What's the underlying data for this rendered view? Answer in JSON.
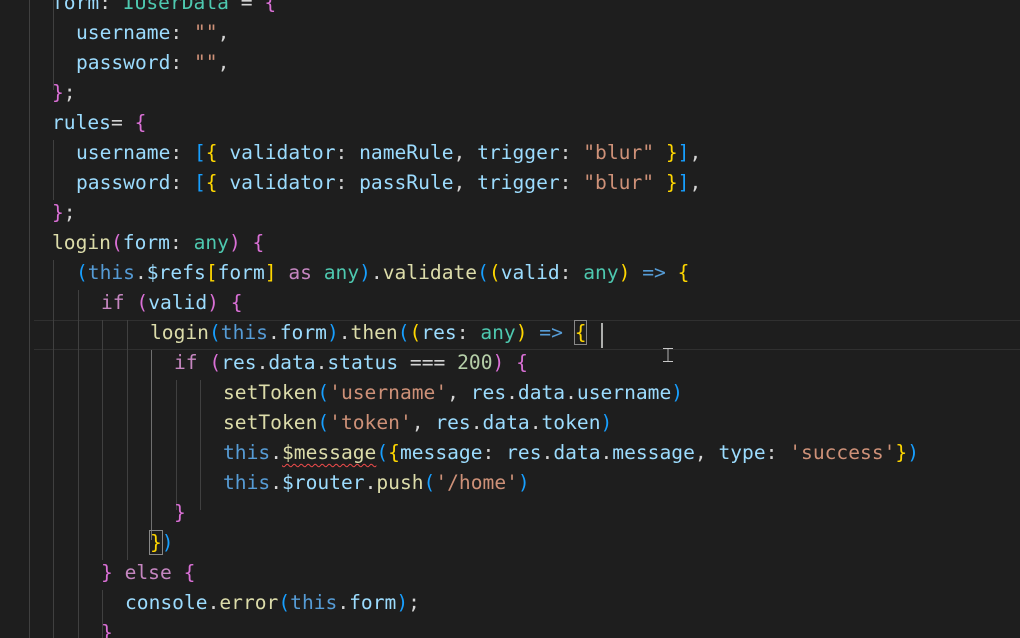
{
  "editor": {
    "language": "TypeScript",
    "cursor_after": "(res: any) => {",
    "lines": [
      [
        [
          "form",
          "p"
        ],
        [
          ": ",
          "o"
        ],
        [
          "IUserData",
          "t"
        ],
        [
          " = ",
          "o"
        ],
        [
          "{",
          "b2"
        ]
      ],
      [
        [
          "username",
          "p"
        ],
        [
          ": ",
          "o"
        ],
        [
          "\"\"",
          "s"
        ],
        [
          ",",
          "o"
        ]
      ],
      [
        [
          "password",
          "p"
        ],
        [
          ": ",
          "o"
        ],
        [
          "\"\"",
          "s"
        ],
        [
          ",",
          "o"
        ]
      ],
      [
        [
          "}",
          "b2"
        ],
        [
          ";",
          "o"
        ]
      ],
      [
        [
          "rules",
          "p"
        ],
        [
          "= ",
          "o"
        ],
        [
          "{",
          "b2"
        ]
      ],
      [
        [
          "username",
          "p"
        ],
        [
          ": ",
          "o"
        ],
        [
          "[",
          "b3"
        ],
        [
          "{",
          "b1"
        ],
        [
          " validator",
          "p"
        ],
        [
          ": ",
          "o"
        ],
        [
          "nameRule",
          "p"
        ],
        [
          ", ",
          "o"
        ],
        [
          "trigger",
          "p"
        ],
        [
          ": ",
          "o"
        ],
        [
          "\"blur\"",
          "s"
        ],
        [
          " ",
          "o"
        ],
        [
          "}",
          "b1"
        ],
        [
          "]",
          "b3"
        ],
        [
          ",",
          "o"
        ]
      ],
      [
        [
          "password",
          "p"
        ],
        [
          ": ",
          "o"
        ],
        [
          "[",
          "b3"
        ],
        [
          "{",
          "b1"
        ],
        [
          " validator",
          "p"
        ],
        [
          ": ",
          "o"
        ],
        [
          "passRule",
          "p"
        ],
        [
          ", ",
          "o"
        ],
        [
          "trigger",
          "p"
        ],
        [
          ": ",
          "o"
        ],
        [
          "\"blur\"",
          "s"
        ],
        [
          " ",
          "o"
        ],
        [
          "}",
          "b1"
        ],
        [
          "]",
          "b3"
        ],
        [
          ",",
          "o"
        ]
      ],
      [
        [
          "}",
          "b2"
        ],
        [
          ";",
          "o"
        ]
      ],
      [
        [
          "login",
          "f"
        ],
        [
          "(",
          "b2"
        ],
        [
          "form",
          "p"
        ],
        [
          ": ",
          "o"
        ],
        [
          "any",
          "t"
        ],
        [
          ") ",
          "b2"
        ],
        [
          "{",
          "b2"
        ]
      ],
      [
        [
          "(",
          "b3"
        ],
        [
          "this",
          "kw"
        ],
        [
          ".",
          "o"
        ],
        [
          "$refs",
          "p"
        ],
        [
          "[",
          "b1"
        ],
        [
          "form",
          "p"
        ],
        [
          "]",
          "b1"
        ],
        [
          " as ",
          "k"
        ],
        [
          "any",
          "t"
        ],
        [
          ")",
          "b3"
        ],
        [
          ".",
          "o"
        ],
        [
          "validate",
          "f"
        ],
        [
          "(",
          "b3"
        ],
        [
          "(",
          "b1"
        ],
        [
          "valid",
          "p"
        ],
        [
          ": ",
          "o"
        ],
        [
          "any",
          "t"
        ],
        [
          ")",
          "b1"
        ],
        [
          " => ",
          "kw"
        ],
        [
          "{",
          "b1"
        ]
      ],
      [
        [
          "if",
          "k"
        ],
        [
          " ",
          "o"
        ],
        [
          "(",
          "b2"
        ],
        [
          "valid",
          "p"
        ],
        [
          ") ",
          "b2"
        ],
        [
          "{",
          "b2"
        ]
      ],
      [
        [
          "login",
          "f"
        ],
        [
          "(",
          "b3"
        ],
        [
          "this",
          "kw"
        ],
        [
          ".",
          "o"
        ],
        [
          "form",
          "p"
        ],
        [
          ")",
          "b3"
        ],
        [
          ".",
          "o"
        ],
        [
          "then",
          "f"
        ],
        [
          "(",
          "b3"
        ],
        [
          "(",
          "b1"
        ],
        [
          "res",
          "p"
        ],
        [
          ": ",
          "o"
        ],
        [
          "any",
          "t"
        ],
        [
          ")",
          "b1"
        ],
        [
          " => ",
          "kw"
        ],
        [
          "{",
          "b1"
        ]
      ],
      [
        [
          "if",
          "k"
        ],
        [
          " ",
          "o"
        ],
        [
          "(",
          "b2"
        ],
        [
          "res",
          "p"
        ],
        [
          ".",
          "o"
        ],
        [
          "data",
          "p"
        ],
        [
          ".",
          "o"
        ],
        [
          "status",
          "p"
        ],
        [
          " === ",
          "o"
        ],
        [
          "200",
          "n"
        ],
        [
          ") ",
          "b2"
        ],
        [
          "{",
          "b2"
        ]
      ],
      [
        [
          "setToken",
          "f"
        ],
        [
          "(",
          "b3"
        ],
        [
          "'username'",
          "s"
        ],
        [
          ", ",
          "o"
        ],
        [
          "res",
          "p"
        ],
        [
          ".",
          "o"
        ],
        [
          "data",
          "p"
        ],
        [
          ".",
          "o"
        ],
        [
          "username",
          "p"
        ],
        [
          ")",
          "b3"
        ]
      ],
      [
        [
          "setToken",
          "f"
        ],
        [
          "(",
          "b3"
        ],
        [
          "'token'",
          "s"
        ],
        [
          ", ",
          "o"
        ],
        [
          "res",
          "p"
        ],
        [
          ".",
          "o"
        ],
        [
          "data",
          "p"
        ],
        [
          ".",
          "o"
        ],
        [
          "token",
          "p"
        ],
        [
          ")",
          "b3"
        ]
      ],
      [
        [
          "this",
          "kw"
        ],
        [
          ".",
          "o"
        ],
        [
          "$message",
          "f"
        ],
        [
          "(",
          "b3"
        ],
        [
          "{",
          "b1"
        ],
        [
          "message",
          "p"
        ],
        [
          ": ",
          "o"
        ],
        [
          "res",
          "p"
        ],
        [
          ".",
          "o"
        ],
        [
          "data",
          "p"
        ],
        [
          ".",
          "o"
        ],
        [
          "message",
          "p"
        ],
        [
          ", ",
          "o"
        ],
        [
          "type",
          "p"
        ],
        [
          ": ",
          "o"
        ],
        [
          "'success'",
          "s"
        ],
        [
          "}",
          "b1"
        ],
        [
          ")",
          "b3"
        ]
      ],
      [
        [
          "this",
          "kw"
        ],
        [
          ".",
          "o"
        ],
        [
          "$router",
          "p"
        ],
        [
          ".",
          "o"
        ],
        [
          "push",
          "f"
        ],
        [
          "(",
          "b3"
        ],
        [
          "'/home'",
          "s"
        ],
        [
          ")",
          "b3"
        ]
      ],
      [
        [
          "}",
          "b2"
        ]
      ],
      [
        [
          "}",
          "b1"
        ],
        [
          ")",
          "b3"
        ]
      ],
      [
        [
          "}",
          "b2"
        ],
        [
          " else ",
          "k"
        ],
        [
          "{",
          "b2"
        ]
      ],
      [
        [
          "console",
          "p"
        ],
        [
          ".",
          "o"
        ],
        [
          "error",
          "f"
        ],
        [
          "(",
          "b3"
        ],
        [
          "this",
          "kw"
        ],
        [
          ".",
          "o"
        ],
        [
          "form",
          "p"
        ],
        [
          ")",
          "b3"
        ],
        [
          ";",
          "o"
        ]
      ],
      [
        [
          "}",
          "b2"
        ]
      ]
    ]
  },
  "icons": {
    "text_cursor": "ibeam-cursor-icon",
    "error_marker": "error-squiggle"
  },
  "colors": {
    "background": "#1e1e1e",
    "keyword": "#c586c0",
    "this_keyword": "#569cd6",
    "variable": "#9cdcfe",
    "function": "#dcdcaa",
    "type": "#4ec9b0",
    "string": "#ce9178",
    "number": "#b5cea8",
    "bracket_gold": "#ffd700",
    "bracket_orchid": "#da70d6",
    "bracket_blue": "#179fff",
    "error": "#f14c4c"
  }
}
